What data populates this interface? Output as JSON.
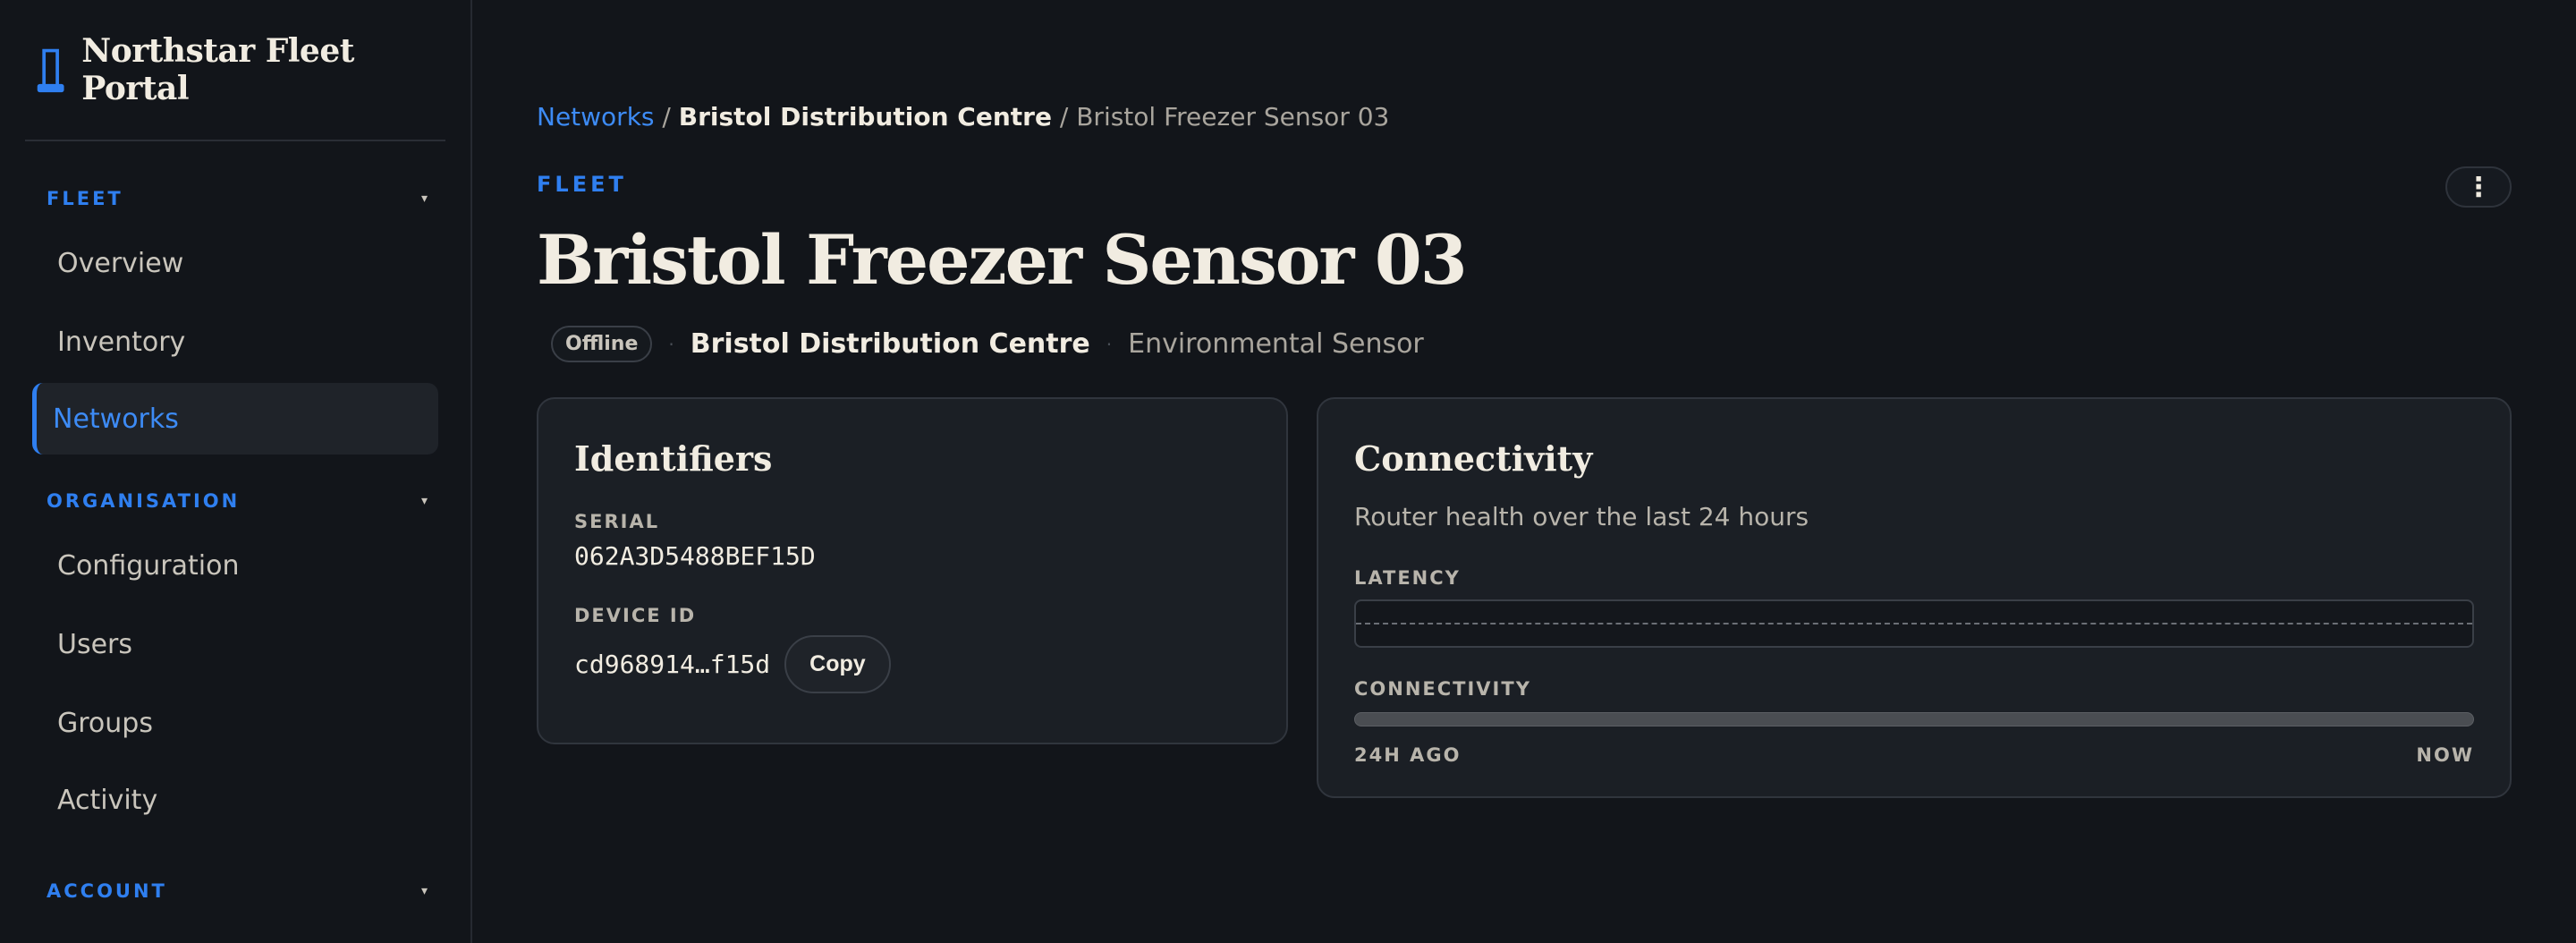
{
  "app": {
    "title": "Northstar Fleet Portal",
    "icon": "tower-icon",
    "accent_color": "#2f7ff0"
  },
  "sidebar": {
    "sections": [
      {
        "label": "FLEET",
        "items": [
          {
            "label": "Overview"
          },
          {
            "label": "Inventory"
          },
          {
            "label": "Networks",
            "active": true
          }
        ]
      },
      {
        "label": "ORGANISATION",
        "items": [
          {
            "label": "Configuration"
          },
          {
            "label": "Users"
          },
          {
            "label": "Groups"
          },
          {
            "label": "Activity"
          }
        ]
      },
      {
        "label": "ACCOUNT",
        "items": []
      }
    ],
    "caret_glyph": "▾"
  },
  "breadcrumb": {
    "items": [
      "Networks",
      "Bristol Distribution Centre",
      "Bristol Freezer Sensor 03"
    ],
    "separator": "/"
  },
  "header": {
    "eyebrow": "FLEET",
    "title": "Bristol Freezer Sensor 03",
    "status": "Offline",
    "site": "Bristol Distribution Centre",
    "device_type": "Environmental Sensor",
    "menu_glyph": "⋮"
  },
  "identifiers": {
    "title": "Identifiers",
    "serial_label": "SERIAL",
    "serial_value": "062A3D5488BEF15D",
    "device_id_label": "DEVICE ID",
    "device_id_value": "cd968914…f15d",
    "copy_label": "Copy"
  },
  "connectivity": {
    "title": "Connectivity",
    "subtitle": "Router health over the last 24 hours",
    "latency_label": "LATENCY",
    "connectivity_label": "CONNECTIVITY",
    "range_start": "24H AGO",
    "range_end": "NOW"
  }
}
